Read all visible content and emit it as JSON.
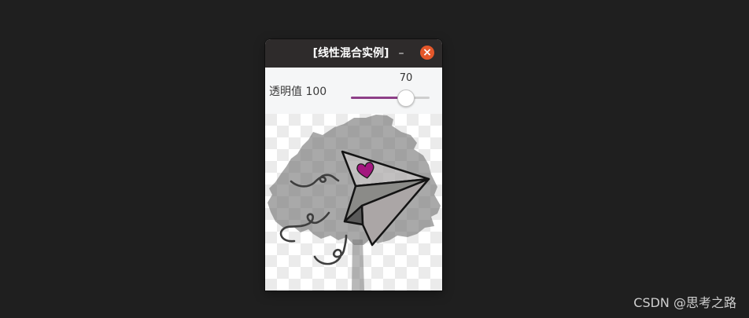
{
  "window": {
    "title": "[线性混合实例]",
    "minimize_label": "–",
    "close_label": "×",
    "close_icon": "close-icon"
  },
  "trackbar": {
    "label": "透明值 100",
    "value": 70,
    "max": 100
  },
  "watermark": "CSDN @思考之路",
  "colors": {
    "desktop_background": "#1f1f1f",
    "titlebar": "#2e2b2b",
    "close_button": "#e4572a",
    "slider_accent": "#8d3f88",
    "panel_background": "#f5f6f7",
    "heart": "#a3177f"
  }
}
